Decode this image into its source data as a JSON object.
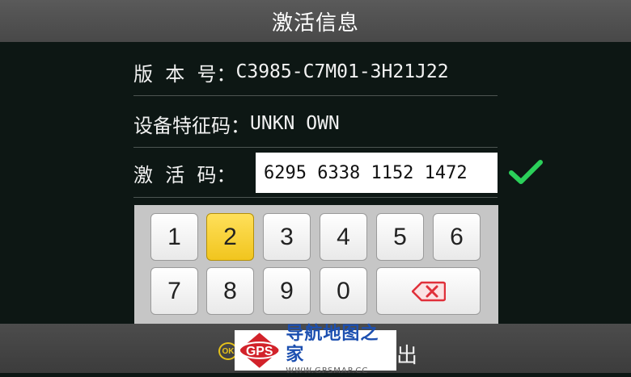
{
  "header": {
    "title": "激活信息"
  },
  "info": {
    "version_label": "版  本  号：",
    "version_value": "C3985-C7M01-3H21J22",
    "device_label": "设备特征码：",
    "device_value": "UNKN OWN",
    "activation_label": "激  活  码：",
    "activation_value": "6295 6338 1152 1472"
  },
  "status": {
    "icon": "check-icon",
    "color": "#2bd05a"
  },
  "keypad": {
    "keys": [
      "1",
      "2",
      "3",
      "4",
      "5",
      "6",
      "7",
      "8",
      "9",
      "0"
    ],
    "active_key": "2",
    "backspace_icon": "backspace-icon",
    "active_color": "#f1c51e",
    "backspace_color": "#e0303a"
  },
  "footer": {
    "ok_icon_text": "OK",
    "exit_label_visible": "出"
  },
  "watermark": {
    "logo_text": "GPS",
    "site_name": "导航地图之家",
    "url": "WWW.GPSMAP.CC"
  }
}
